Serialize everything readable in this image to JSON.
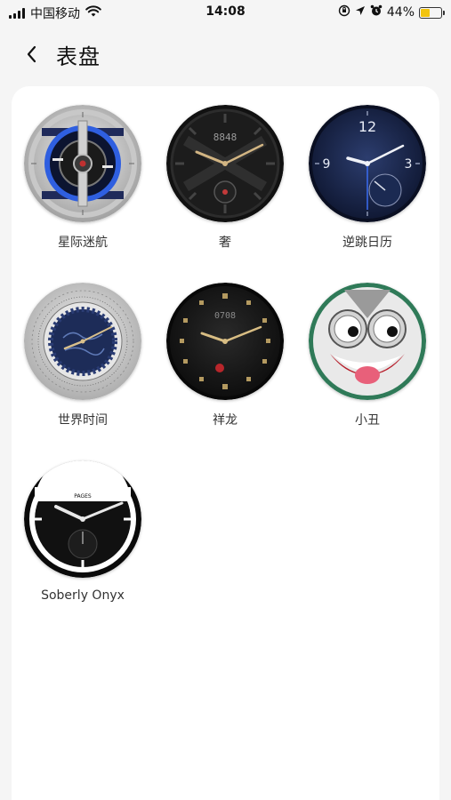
{
  "status_bar": {
    "carrier": "中国移动",
    "time": "14:08",
    "battery_percent_text": "44%",
    "battery_level": 0.44
  },
  "header": {
    "title": "表盘",
    "back_icon": "chevron-left-icon"
  },
  "watch_faces": [
    {
      "label": "星际迷航"
    },
    {
      "label": "奢",
      "digital_time": "8848"
    },
    {
      "label": "逆跳日历",
      "numeral_12": "12",
      "numeral_3": "3",
      "numeral_9": "9"
    },
    {
      "label": "世界时间"
    },
    {
      "label": "祥龙",
      "digital_time": "0708"
    },
    {
      "label": "小丑"
    },
    {
      "label": "Soberly Onyx",
      "brand": "PAGES"
    }
  ],
  "colors": {
    "card_background": "#ffffff",
    "page_background": "#f5f5f5",
    "battery_fill": "#f2c40f"
  }
}
